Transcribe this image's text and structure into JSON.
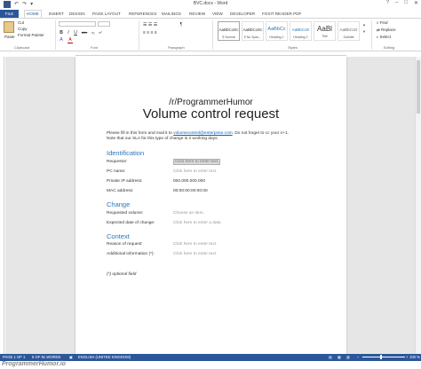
{
  "window": {
    "title": "BVC.docx - Word",
    "app_icon_letter": "W",
    "quick_access": [
      "↶",
      "↷",
      "▾"
    ],
    "controls": [
      "?",
      "–",
      "□",
      "✕"
    ]
  },
  "tabs": [
    "FILE",
    "HOME",
    "INSERT",
    "DESIGN",
    "PAGE LAYOUT",
    "REFERENCES",
    "MAILINGS",
    "REVIEW",
    "VIEW",
    "DEVELOPER",
    "FOXIT READER PDF"
  ],
  "ribbon": {
    "clipboard": {
      "paste": "Paste",
      "cut": "Cut",
      "copy": "Copy",
      "format_painter": "Format Painter",
      "label": "Clipboard"
    },
    "font": {
      "label": "Font",
      "buttons": [
        "B",
        "I",
        "U",
        "abc",
        "x₂",
        "x²",
        "A",
        "A"
      ]
    },
    "paragraph": {
      "label": "Paragraph"
    },
    "styles": {
      "label": "Styles",
      "tiles": [
        {
          "sample": "AaBbCcDc",
          "name": "¶ Normal"
        },
        {
          "sample": "AaBbCcDc",
          "name": "¶ No Spac..."
        },
        {
          "sample": "AaBbCc",
          "name": "Heading 1"
        },
        {
          "sample": "AaBbCcE",
          "name": "Heading 2"
        },
        {
          "sample": "AaBl",
          "name": "Title"
        },
        {
          "sample": "AaBbCcD",
          "name": "Subtitle"
        }
      ]
    },
    "editing": {
      "label": "Editing",
      "find": "Find",
      "replace": "Replace",
      "select": "Select"
    }
  },
  "document": {
    "subtitle": "/r/ProgrammerHumor",
    "title": "Volume control request",
    "intro_prefix": "Please fill in this form and mail it to ",
    "intro_email": "volumecontrol@enterprise.com",
    "intro_suffix": ". Do not forget to cc your n+1.",
    "intro_line2": "Note that our SLA for this type of change is 2 working days.",
    "sections": {
      "identification": {
        "heading": "Identification",
        "fields": [
          {
            "label": "Requestor:",
            "value": "Click here to enter text."
          },
          {
            "label": "PC name:",
            "value": "Click here to enter text."
          },
          {
            "label": "Private IP address:",
            "value": "000.000.000.000"
          },
          {
            "label": "MAC address:",
            "value": "00:00:00:00:00:00"
          }
        ]
      },
      "change": {
        "heading": "Change",
        "fields": [
          {
            "label": "Requested volume:",
            "value": "Choose an item."
          },
          {
            "label": "Expected date of change:",
            "value": "Click here to enter a date."
          }
        ]
      },
      "context": {
        "heading": "Context",
        "fields": [
          {
            "label": "Reason of request:",
            "value": "Click here to enter text."
          },
          {
            "label": "Additional information (*):",
            "value": "Click here to enter text."
          }
        ]
      }
    },
    "optional_note": "(*) optional field"
  },
  "status": {
    "page": "PAGE 1 OF 1",
    "words": "5 OF 91 WORDS",
    "language": "ENGLISH (UNITED KINGDOM)",
    "zoom": "100 %",
    "zoom_minus": "–",
    "zoom_plus": "+"
  },
  "watermark": "ProgrammerHumor.io",
  "colors": {
    "word_blue": "#2b579a",
    "heading_blue": "#2e74b5",
    "link_blue": "#0563c1"
  }
}
